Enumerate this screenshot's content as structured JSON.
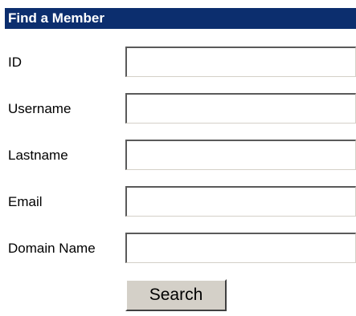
{
  "panel": {
    "title": "Find a Member"
  },
  "fields": [
    {
      "label": "ID",
      "value": ""
    },
    {
      "label": "Username",
      "value": ""
    },
    {
      "label": "Lastname",
      "value": ""
    },
    {
      "label": "Email",
      "value": ""
    },
    {
      "label": "Domain Name",
      "value": ""
    }
  ],
  "actions": {
    "search_label": "Search"
  },
  "colors": {
    "header_background": "#0c2e6e",
    "header_text": "#ffffff",
    "button_face": "#d4d0c8"
  }
}
